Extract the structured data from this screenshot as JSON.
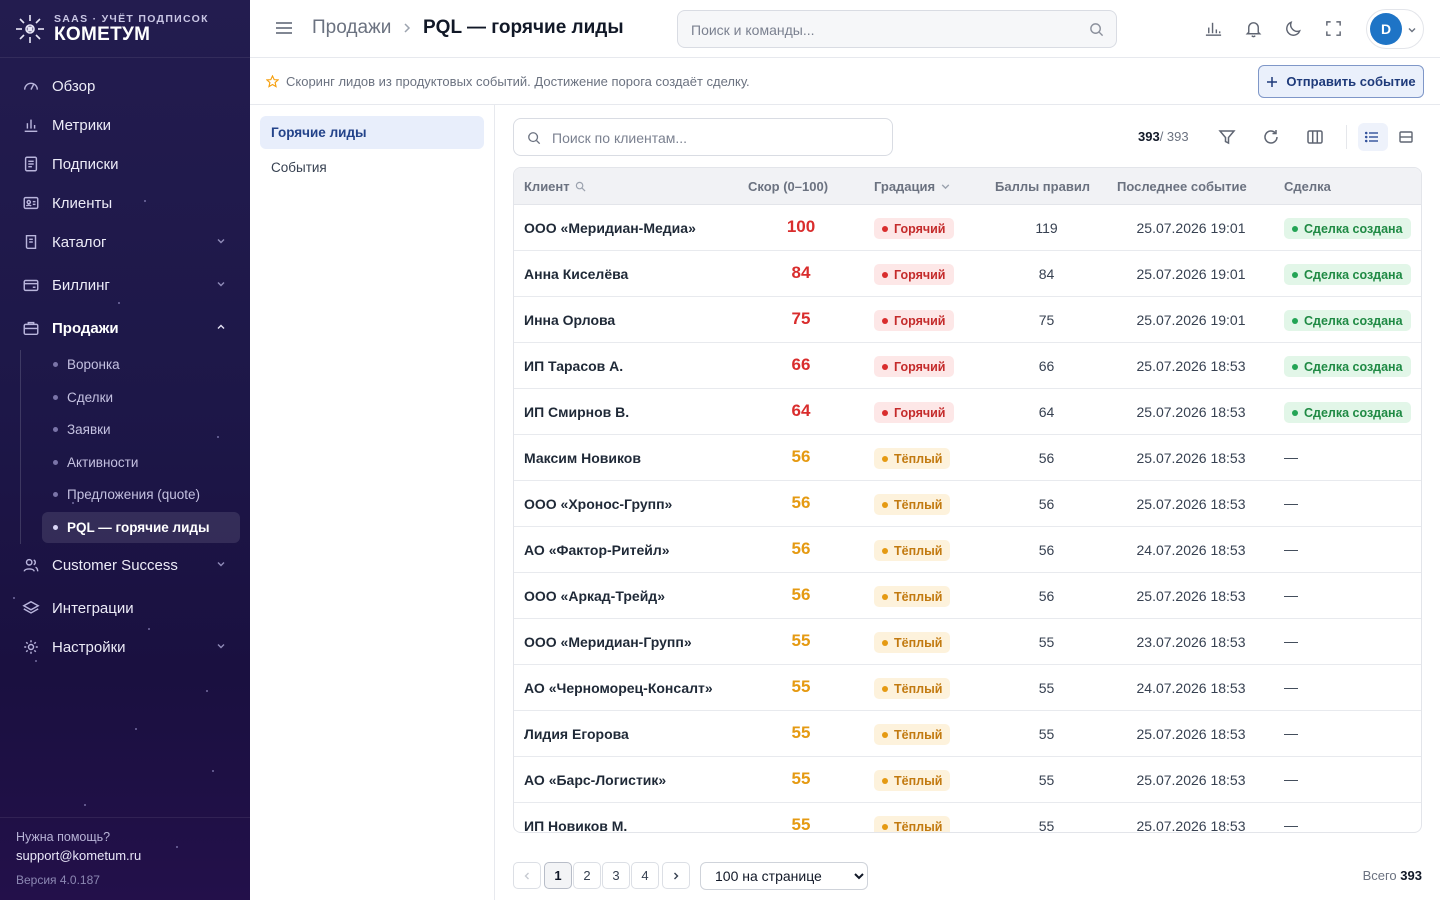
{
  "brand": {
    "subtitle": "SAAS · УЧЁТ ПОДПИСОК",
    "name": "КОМЕТУМ"
  },
  "sidebar": {
    "items": [
      {
        "label": "Обзор",
        "icon": "gauge-icon",
        "expandable": false
      },
      {
        "label": "Метрики",
        "icon": "bar-chart-icon",
        "expandable": false
      },
      {
        "label": "Подписки",
        "icon": "receipt-icon",
        "expandable": false
      },
      {
        "label": "Клиенты",
        "icon": "id-card-icon",
        "expandable": false
      },
      {
        "label": "Каталог",
        "icon": "book-icon",
        "expandable": true
      },
      {
        "label": "Биллинг",
        "icon": "wallet-icon",
        "expandable": true
      },
      {
        "label": "Продажи",
        "icon": "briefcase-icon",
        "expandable": true,
        "open": true
      },
      {
        "label": "Customer Success",
        "icon": "users-icon",
        "expandable": true
      },
      {
        "label": "Интеграции",
        "icon": "layers-icon",
        "expandable": false
      },
      {
        "label": "Настройки",
        "icon": "gear-icon",
        "expandable": true
      }
    ],
    "sales_children": [
      "Воронка",
      "Сделки",
      "Заявки",
      "Активности",
      "Предложения (quote)",
      "PQL — горячие лиды"
    ],
    "active_child": "PQL — горячие лиды",
    "help_label": "Нужна помощь?",
    "help_email": "support@kometum.ru",
    "version": "Версия 4.0.187"
  },
  "header": {
    "breadcrumb_parent": "Продажи",
    "breadcrumb_current": "PQL — горячие лиды",
    "search_placeholder": "Поиск и команды...",
    "avatar_letter": "D"
  },
  "infobar": {
    "text": "Скоринг лидов из продуктовых событий. Достижение порога создаёт сделку.",
    "send_button": "Отправить событие"
  },
  "tabs": [
    {
      "label": "Горячие лиды",
      "active": true
    },
    {
      "label": "События",
      "active": false
    }
  ],
  "toolbar": {
    "search_placeholder": "Поиск по клиентам...",
    "count_shown": "393",
    "count_total": "/ 393"
  },
  "table": {
    "columns": {
      "client": "Клиент",
      "score": "Скор (0–100)",
      "grade": "Градация",
      "points": "Баллы правил",
      "last_event": "Последнее событие",
      "deal": "Сделка"
    },
    "rows": [
      {
        "client": "ООО «Меридиан-Медиа»",
        "score": "100",
        "grade": "Горячий",
        "level": "hot",
        "points": "119",
        "last_event": "25.07.2026 19:01",
        "deal": "Сделка создана"
      },
      {
        "client": "Анна Киселёва",
        "score": "84",
        "grade": "Горячий",
        "level": "hot",
        "points": "84",
        "last_event": "25.07.2026 19:01",
        "deal": "Сделка создана"
      },
      {
        "client": "Инна Орлова",
        "score": "75",
        "grade": "Горячий",
        "level": "hot",
        "points": "75",
        "last_event": "25.07.2026 19:01",
        "deal": "Сделка создана"
      },
      {
        "client": "ИП Тарасов А.",
        "score": "66",
        "grade": "Горячий",
        "level": "hot",
        "points": "66",
        "last_event": "25.07.2026 18:53",
        "deal": "Сделка создана"
      },
      {
        "client": "ИП Смирнов В.",
        "score": "64",
        "grade": "Горячий",
        "level": "hot",
        "points": "64",
        "last_event": "25.07.2026 18:53",
        "deal": "Сделка создана"
      },
      {
        "client": "Максим Новиков",
        "score": "56",
        "grade": "Тёплый",
        "level": "warm",
        "points": "56",
        "last_event": "25.07.2026 18:53",
        "deal": "—"
      },
      {
        "client": "ООО «Хронос-Групп»",
        "score": "56",
        "grade": "Тёплый",
        "level": "warm",
        "points": "56",
        "last_event": "25.07.2026 18:53",
        "deal": "—"
      },
      {
        "client": "АО «Фактор-Ритейл»",
        "score": "56",
        "grade": "Тёплый",
        "level": "warm",
        "points": "56",
        "last_event": "24.07.2026 18:53",
        "deal": "—"
      },
      {
        "client": "ООО «Аркад-Трейд»",
        "score": "56",
        "grade": "Тёплый",
        "level": "warm",
        "points": "56",
        "last_event": "25.07.2026 18:53",
        "deal": "—"
      },
      {
        "client": "ООО «Меридиан-Групп»",
        "score": "55",
        "grade": "Тёплый",
        "level": "warm",
        "points": "55",
        "last_event": "23.07.2026 18:53",
        "deal": "—"
      },
      {
        "client": "АО «Черноморец-Консалт»",
        "score": "55",
        "grade": "Тёплый",
        "level": "warm",
        "points": "55",
        "last_event": "24.07.2026 18:53",
        "deal": "—"
      },
      {
        "client": "Лидия Егорова",
        "score": "55",
        "grade": "Тёплый",
        "level": "warm",
        "points": "55",
        "last_event": "25.07.2026 18:53",
        "deal": "—"
      },
      {
        "client": "АО «Барс-Логистик»",
        "score": "55",
        "grade": "Тёплый",
        "level": "warm",
        "points": "55",
        "last_event": "25.07.2026 18:53",
        "deal": "—"
      },
      {
        "client": "ИП Новиков М.",
        "score": "55",
        "grade": "Тёплый",
        "level": "warm",
        "points": "55",
        "last_event": "25.07.2026 18:53",
        "deal": "—"
      }
    ]
  },
  "pagination": {
    "pages": [
      "1",
      "2",
      "3",
      "4"
    ],
    "current": "1",
    "per_page": "100 на странице",
    "total_label": "Всего",
    "total": "393"
  },
  "colors": {
    "sidebar_bg": "#1d1748",
    "accent": "#23438a",
    "hot": "#d92d2d",
    "warm": "#e59a12",
    "deal_green": "#1f8a44",
    "avatar": "#1e74c6"
  }
}
